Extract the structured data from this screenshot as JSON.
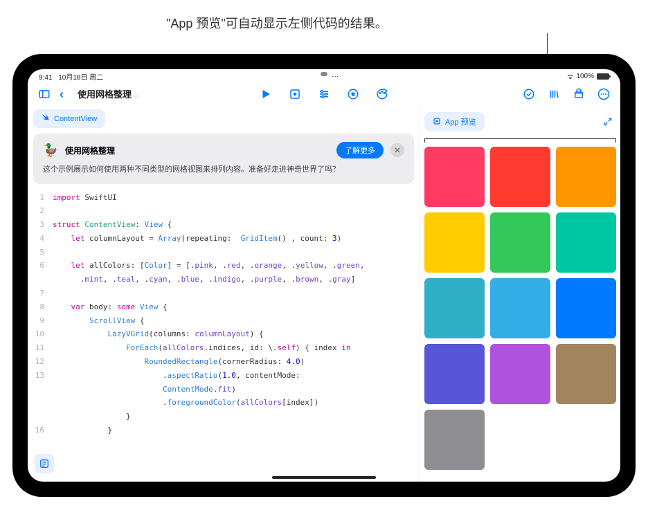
{
  "annotation": "\"App 预览\"可自动显示左侧代码的结果。",
  "status": {
    "time": "9:41",
    "date": "10月18日 周二",
    "dots": "···",
    "wifi": "ᯤ",
    "battery_pct": "100%"
  },
  "toolbar": {
    "doc_title": "使用网格整理"
  },
  "file_tab": "ContentView",
  "info_card": {
    "title": "使用网格整理",
    "learn_more": "了解更多",
    "body": "这个示例展示如何使用两种不同类型的网格视图来排列内容。准备好走进神奇世界了吗？"
  },
  "preview": {
    "tab_label": "App 预览",
    "colors": [
      "#ff3b62",
      "#ff3b30",
      "#ff9500",
      "#ffcc00",
      "#34c759",
      "#00c7a3",
      "#30b0c7",
      "#32ade6",
      "#007aff",
      "#5856d6",
      "#af52de",
      "#a2845e",
      "#8e8e93"
    ]
  },
  "code": {
    "lines": [
      {
        "n": 1,
        "html": "<span class='kw'>import</span> SwiftUI"
      },
      {
        "n": 2,
        "html": ""
      },
      {
        "n": 3,
        "html": "<span class='kw'>struct</span> <span class='typeUser'>ContentView</span>: <span class='type'>View</span> {"
      },
      {
        "n": 4,
        "html": "    <span class='kw'>let</span> columnLayout = <span class='type'>Array</span>(repeating:  <span class='type'>GridItem</span>() , count: <span class='num'>3</span>)"
      },
      {
        "n": 5,
        "html": ""
      },
      {
        "n": 6,
        "html": "    <span class='kw'>let</span> allColors: [<span class='type'>Color</span>] = [.<span class='prop'>pink</span>, .<span class='prop'>red</span>, .<span class='prop'>orange</span>, .<span class='prop'>yellow</span>, .<span class='prop'>green</span>,"
      },
      {
        "n": "",
        "html": "      .<span class='prop'>mint</span>, .<span class='prop'>teal</span>, .<span class='prop'>cyan</span>, .<span class='prop'>blue</span>, .<span class='prop'>indigo</span>, .<span class='prop'>purple</span>, .<span class='prop'>brown</span>, .<span class='prop'>gray</span>]"
      },
      {
        "n": 7,
        "html": ""
      },
      {
        "n": 8,
        "html": "    <span class='kw'>var</span> body: <span class='kw'>some</span> <span class='type'>View</span> {"
      },
      {
        "n": 9,
        "html": "        <span class='type'>ScrollView</span> {"
      },
      {
        "n": 10,
        "html": "            <span class='type'>LazyVGrid</span>(columns: <span class='prop'>columnLayout</span>) {"
      },
      {
        "n": 11,
        "html": "                <span class='type'>ForEach</span>(<span class='prop'>allColors</span>.indices, id: \\.<span class='kw'>self</span>) { index <span class='kw'>in</span>"
      },
      {
        "n": 12,
        "html": "                    <span class='type'>RoundedRectangle</span>(cornerRadius: <span class='num'>4.0</span>)"
      },
      {
        "n": 13,
        "html": "                        .<span class='fn'>aspectRatio</span>(<span class='num'>1.0</span>, contentMode:"
      },
      {
        "n": "",
        "html": "                        <span class='type'>ContentMode</span>.<span class='prop'>fit</span>)"
      },
      {
        "n": "",
        "html": "                        .<span class='fn'>foregroundColor</span>(<span class='prop'>allColors</span>[index])"
      },
      {
        "n": "",
        "html": "                }"
      },
      {
        "n": 16,
        "html": "            }"
      }
    ]
  }
}
